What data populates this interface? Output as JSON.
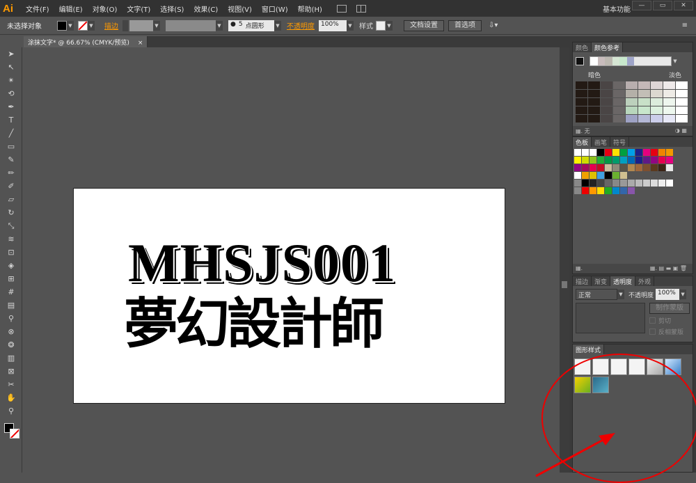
{
  "app": {
    "logo": "Ai",
    "workspace": "基本功能"
  },
  "menu": [
    "文件(F)",
    "编辑(E)",
    "对象(O)",
    "文字(T)",
    "选择(S)",
    "效果(C)",
    "视图(V)",
    "窗口(W)",
    "帮助(H)"
  ],
  "control": {
    "selection": "未选择对象",
    "stroke_label": "描边",
    "brush_num": "5",
    "brush_label": "点圆形",
    "opacity_label": "不透明度",
    "opacity_value": "100%",
    "style_label": "样式",
    "doc_setup": "文档设置",
    "prefs": "首选项"
  },
  "document": {
    "tab": "涂抹文字* @ 66.67% (CMYK/预览)",
    "close": "×"
  },
  "artwork": {
    "line1": "MHSJS001",
    "line2": "夢幻設計師"
  },
  "color_panel": {
    "tabs": [
      "颜色",
      "颜色参考"
    ],
    "dark": "暗色",
    "light": "淡色",
    "none": "无"
  },
  "swatch_panel": {
    "tabs": [
      "色板",
      "画笔",
      "符号"
    ]
  },
  "transparency_panel": {
    "tabs": [
      "描边",
      "渐变",
      "透明度",
      "外观"
    ],
    "mode": "正常",
    "opacity_label": "不透明度",
    "opacity_value": "100%",
    "make_mask": "制作蒙版",
    "clip": "剪切",
    "invert": "反相蒙版"
  },
  "graphic_styles": {
    "tab": "图形样式"
  },
  "colors": {
    "accent": "#ff9a00",
    "annotation": "#e00000"
  }
}
